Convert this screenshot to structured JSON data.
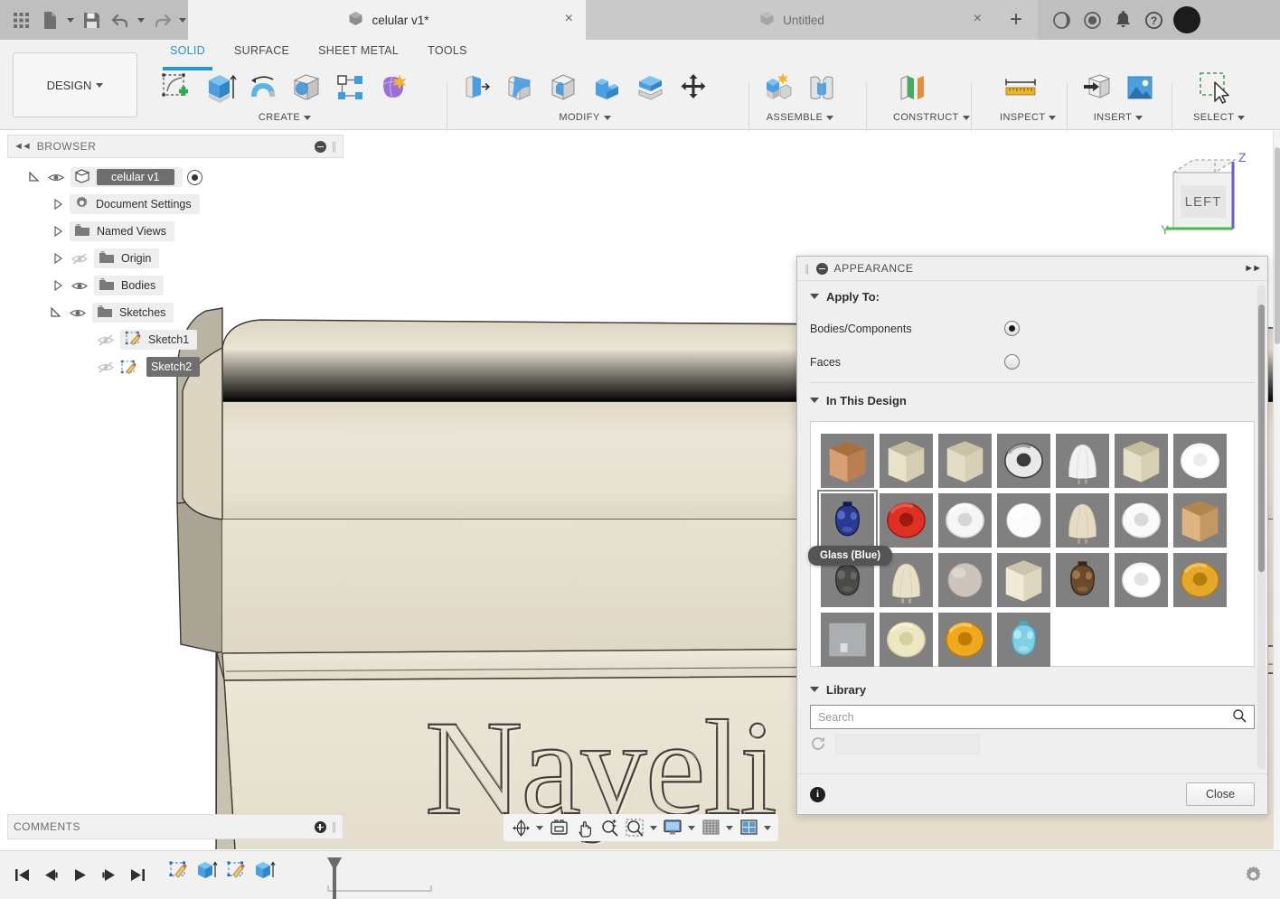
{
  "window": {
    "quick_access": [
      {
        "name": "app-grid-icon",
        "label": "Show Data Panel"
      },
      {
        "name": "new-file-icon",
        "label": "File"
      },
      {
        "name": "save-icon",
        "label": "Save"
      },
      {
        "name": "undo-icon",
        "label": "Undo"
      },
      {
        "name": "redo-icon",
        "label": "Redo"
      }
    ],
    "tabs": [
      {
        "title": "celular v1*",
        "active": true,
        "close": "×"
      },
      {
        "title": "Untitled",
        "active": false,
        "close": "×"
      }
    ],
    "new_tab_label": "+",
    "top_right_icons": [
      {
        "name": "extensions-icon"
      },
      {
        "name": "job-status-icon"
      },
      {
        "name": "notifications-bell-icon"
      },
      {
        "name": "help-icon"
      },
      {
        "name": "user-avatar"
      }
    ]
  },
  "ribbon": {
    "workspace": "DESIGN",
    "tabs": [
      {
        "label": "SOLID",
        "selected": true
      },
      {
        "label": "SURFACE",
        "selected": false
      },
      {
        "label": "SHEET METAL",
        "selected": false
      },
      {
        "label": "TOOLS",
        "selected": false
      }
    ],
    "groups": [
      {
        "label": "CREATE",
        "icons": [
          {
            "name": "create-sketch-icon"
          },
          {
            "name": "extrude-icon"
          },
          {
            "name": "revolve-icon"
          },
          {
            "name": "hole-icon"
          },
          {
            "name": "pattern-icon"
          },
          {
            "name": "form-icon"
          }
        ]
      },
      {
        "label": "MODIFY",
        "icons": [
          {
            "name": "press-pull-icon"
          },
          {
            "name": "fillet-icon"
          },
          {
            "name": "shell-icon"
          },
          {
            "name": "combine-icon"
          },
          {
            "name": "split-body-icon"
          },
          {
            "name": "move-copy-icon"
          }
        ]
      },
      {
        "label": "ASSEMBLE",
        "icons": [
          {
            "name": "new-component-icon"
          },
          {
            "name": "joint-icon"
          }
        ]
      },
      {
        "label": "CONSTRUCT",
        "icons": [
          {
            "name": "offset-plane-icon"
          }
        ]
      },
      {
        "label": "INSPECT",
        "icons": [
          {
            "name": "measure-icon"
          }
        ]
      },
      {
        "label": "INSERT",
        "icons": [
          {
            "name": "insert-derive-icon"
          },
          {
            "name": "canvas-image-icon"
          }
        ]
      },
      {
        "label": "SELECT",
        "icons": [
          {
            "name": "select-window-icon"
          }
        ]
      }
    ]
  },
  "browser": {
    "title": "BROWSER",
    "items": [
      {
        "label": "celular v1",
        "depth": 0,
        "expanded": true,
        "visible": true,
        "icon": "component-icon",
        "selected_name": true,
        "has_radio": true
      },
      {
        "label": "Document Settings",
        "depth": 1,
        "expanded": false,
        "visible": null,
        "icon": "gear-icon"
      },
      {
        "label": "Named Views",
        "depth": 1,
        "expanded": false,
        "visible": null,
        "icon": "folder-icon"
      },
      {
        "label": "Origin",
        "depth": 1,
        "expanded": false,
        "visible": false,
        "icon": "folder-icon"
      },
      {
        "label": "Bodies",
        "depth": 1,
        "expanded": false,
        "visible": true,
        "icon": "folder-icon"
      },
      {
        "label": "Sketches",
        "depth": 1,
        "expanded": true,
        "visible": true,
        "icon": "folder-icon"
      },
      {
        "label": "Sketch1",
        "depth": 2,
        "expanded": null,
        "visible": false,
        "icon": "sketch-icon",
        "selected": false
      },
      {
        "label": "Sketch2",
        "depth": 2,
        "expanded": null,
        "visible": false,
        "icon": "sketch-icon",
        "selected": true
      }
    ]
  },
  "comments": {
    "title": "COMMENTS"
  },
  "viewport": {
    "model_text": "Nayeli",
    "model_color": "#e9e3d3",
    "model_color_dark": "#d9d2bf",
    "model_color_edge": "#3d3a33",
    "background": "#ffffff",
    "viewcube": {
      "face_label": "LEFT",
      "axes": [
        {
          "label": "Z",
          "color": "#6a5acd"
        },
        {
          "label": "Y",
          "color": "#3fbf3f"
        }
      ]
    }
  },
  "navbar": {
    "buttons": [
      {
        "name": "orbit-icon",
        "has_caret": true
      },
      {
        "name": "look-at-icon",
        "has_caret": false
      },
      {
        "name": "pan-icon",
        "has_caret": false
      },
      {
        "name": "zoom-icon",
        "has_caret": false
      },
      {
        "name": "zoom-window-icon",
        "has_caret": true
      },
      {
        "name": "display-settings-icon",
        "has_caret": true
      },
      {
        "name": "grid-snaps-icon",
        "has_caret": true
      },
      {
        "name": "viewports-icon",
        "has_caret": true
      }
    ]
  },
  "timeline": {
    "playback": [
      {
        "name": "go-to-beginning-icon"
      },
      {
        "name": "step-back-icon"
      },
      {
        "name": "play-icon"
      },
      {
        "name": "step-forward-icon"
      },
      {
        "name": "go-to-end-icon"
      }
    ],
    "features": [
      {
        "name": "timeline-sketch1-icon"
      },
      {
        "name": "timeline-extrude1-icon"
      },
      {
        "name": "timeline-sketch2-icon"
      },
      {
        "name": "timeline-extrude2-icon"
      }
    ],
    "marker_name": "timeline-marker",
    "settings_icon": "gear-icon"
  },
  "appearance": {
    "title": "APPEARANCE",
    "collapse_icon": "minus-circle-icon",
    "expand_icon": "expand-right-icon",
    "apply_to": {
      "label": "Apply To:",
      "options": [
        {
          "label": "Bodies/Components",
          "selected": true
        },
        {
          "label": "Faces",
          "selected": false
        }
      ]
    },
    "in_this_design": {
      "label": "In This Design",
      "swatches": [
        {
          "name": "oak-wood",
          "shape": "cube",
          "c1": "#d8a071",
          "c2": "#b97f51",
          "c3": "#a86f43"
        },
        {
          "name": "plastic-cream",
          "shape": "cube",
          "c1": "#e8e2cb",
          "c2": "#d4cdb2",
          "c3": "#c2bb9f"
        },
        {
          "name": "maple-light",
          "shape": "cube",
          "c1": "#e4ddc6",
          "c2": "#d8d0b5",
          "c3": "#cbc2a4"
        },
        {
          "name": "chrome-torus",
          "shape": "torus",
          "c1": "#e9e9e9",
          "c2": "#3c3c3c",
          "c3": "#8d8d8d"
        },
        {
          "name": "fabric-white",
          "shape": "cloth",
          "c1": "#f2f2f2",
          "c2": "#cfcfcf",
          "c3": "#a9a9a9"
        },
        {
          "name": "plastic-beige",
          "shape": "cube",
          "c1": "#e6e0c8",
          "c2": "#d6cfb4",
          "c3": "#c5bd9e"
        },
        {
          "name": "paint-white-gloss",
          "shape": "torus",
          "c1": "#ffffff",
          "c2": "#ededed",
          "c3": "#f7f7f7"
        },
        {
          "name": "glass-blue",
          "shape": "vase",
          "c1": "#2b3a8f",
          "c2": "#101a4a",
          "c3": "#5a6fd0",
          "selected": true
        },
        {
          "name": "plastic-red",
          "shape": "torus",
          "c1": "#e03024",
          "c2": "#9c1a12",
          "c3": "#f06458"
        },
        {
          "name": "plastic-white",
          "shape": "torus",
          "c1": "#f6f6f6",
          "c2": "#d6d6d6",
          "c3": "#ffffff"
        },
        {
          "name": "paint-white-sphere",
          "shape": "sphere",
          "c1": "#fbfbfb",
          "c2": "#d2d2d2",
          "c3": "#ffffff"
        },
        {
          "name": "fabric-tan",
          "shape": "cloth",
          "c1": "#e6dcc6",
          "c2": "#cfc3a7",
          "c3": "#b6a98c"
        },
        {
          "name": "ceramic-white",
          "shape": "torus",
          "c1": "#fafafa",
          "c2": "#d9d9d9",
          "c3": "#ffffff"
        },
        {
          "name": "birch-wood",
          "shape": "cube",
          "c1": "#dfb480",
          "c2": "#c69861",
          "c3": "#b2854f"
        },
        {
          "name": "concrete-dark",
          "shape": "vase",
          "c1": "#4a4a48",
          "c2": "#2b2b2a",
          "c3": "#6c6c69"
        },
        {
          "name": "fabric-linen",
          "shape": "cloth",
          "c1": "#e8e0c9",
          "c2": "#d3c9ac",
          "c3": "#bdb292"
        },
        {
          "name": "stone-speckled",
          "shape": "sphere",
          "c1": "#cdc5bc",
          "c2": "#a79d92",
          "c3": "#e0dad3"
        },
        {
          "name": "plastic-ivory-cube",
          "shape": "cube",
          "c1": "#efe9d6",
          "c2": "#ded7c0",
          "c3": "#cdc5ab"
        },
        {
          "name": "glass-brown",
          "shape": "vase",
          "c1": "#6b4a2c",
          "c2": "#3c2714",
          "c3": "#a07a52"
        },
        {
          "name": "paint-white-matte",
          "shape": "torus",
          "c1": "#ffffff",
          "c2": "#e2e2e2",
          "c3": "#f4f4f4"
        },
        {
          "name": "glass-amber",
          "shape": "torus",
          "c1": "#e7a82a",
          "c2": "#b47c0c",
          "c3": "#f6cf6a"
        },
        {
          "name": "glass-clear",
          "shape": "room",
          "c1": "#cfd4d6",
          "c2": "#aab1b4",
          "c3": "#e8ecee"
        },
        {
          "name": "plastic-pale-yellow",
          "shape": "torus",
          "c1": "#eee8c2",
          "c2": "#d6cf9e",
          "c3": "#f8f4d8"
        },
        {
          "name": "plastic-orange",
          "shape": "torus",
          "c1": "#f0a81f",
          "c2": "#c07a00",
          "c3": "#ffd372"
        },
        {
          "name": "glass-light-blue",
          "shape": "vase",
          "c1": "#7fd0e4",
          "c2": "#4aa8c2",
          "c3": "#b7ecf6"
        }
      ],
      "tooltip": "Glass (Blue)"
    },
    "library": {
      "label": "Library",
      "search_placeholder": "Search",
      "search_value": "",
      "search_icon": "search-icon"
    },
    "footer": {
      "info_icon": "info-icon",
      "close_label": "Close"
    }
  }
}
